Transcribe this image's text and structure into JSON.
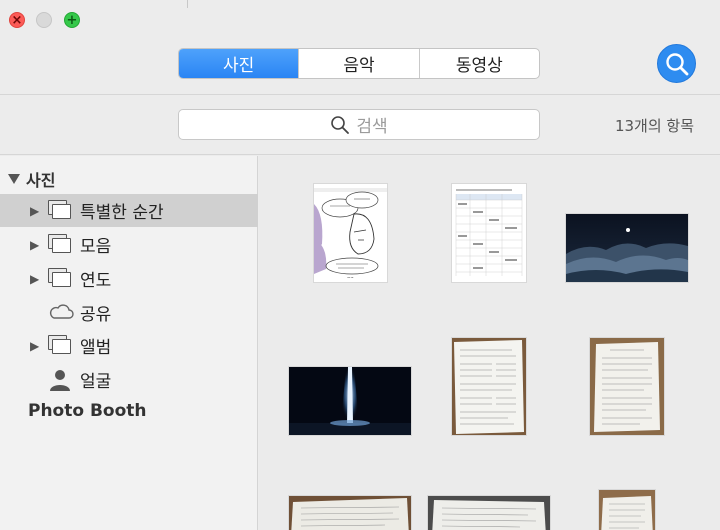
{
  "tabs": [
    {
      "label": "사진",
      "active": true
    },
    {
      "label": "음악",
      "active": false
    },
    {
      "label": "동영상",
      "active": false
    }
  ],
  "search": {
    "placeholder": "검색"
  },
  "item_count": "13개의 항목",
  "sidebar": {
    "header": "사진",
    "items": [
      {
        "label": "특별한 순간",
        "icon": "photo-stack-icon",
        "selected": true
      },
      {
        "label": "모음",
        "icon": "photo-stack-icon"
      },
      {
        "label": "연도",
        "icon": "photo-stack-icon"
      },
      {
        "label": "공유",
        "icon": "cloud-icon"
      },
      {
        "label": "앨범",
        "icon": "photo-stack-icon"
      },
      {
        "label": "얼굴",
        "icon": "person-icon"
      }
    ],
    "photo_booth": "Photo Booth"
  },
  "colors": {
    "accent": "#2e8cf0",
    "selection": "#d0d0d0"
  },
  "thumbnails": [
    {
      "name": "thumb-comic"
    },
    {
      "name": "thumb-spreadsheet"
    },
    {
      "name": "thumb-night-clouds"
    },
    {
      "name": "thumb-light-beam"
    },
    {
      "name": "thumb-document-1"
    },
    {
      "name": "thumb-document-2"
    },
    {
      "name": "thumb-document-3"
    },
    {
      "name": "thumb-document-4"
    },
    {
      "name": "thumb-document-5"
    }
  ]
}
